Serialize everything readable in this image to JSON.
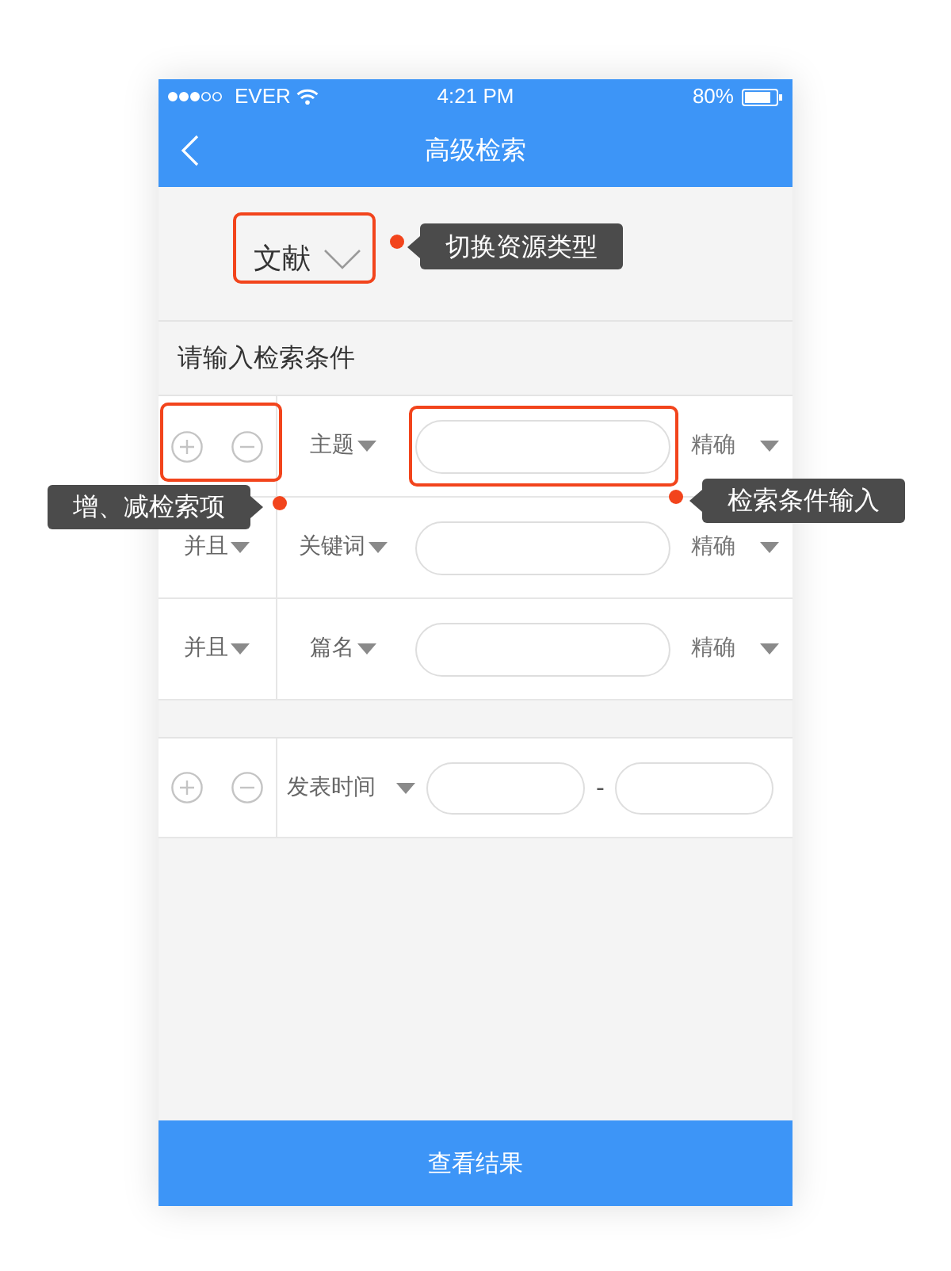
{
  "status_bar": {
    "carrier": "EVER",
    "time": "4:21 PM",
    "battery": "80%"
  },
  "nav_bar": {
    "title": "高级检索"
  },
  "resource_type": {
    "value": "文献"
  },
  "section_label": "请输入检索条件",
  "conditions": [
    {
      "kind": "add-remove",
      "field": "主题",
      "match": "精确"
    },
    {
      "kind": "logic",
      "logic": "并且",
      "field": "关键词",
      "match": "精确"
    },
    {
      "kind": "logic",
      "logic": "并且",
      "field": "篇名",
      "match": "精确"
    }
  ],
  "date_filter": {
    "field": "发表时间",
    "separator": "-"
  },
  "submit_button": "查看结果",
  "annotations": [
    {
      "kind": "resource-type",
      "text": "切换资源类型"
    },
    {
      "kind": "add-remove",
      "text": "增、减检索项"
    },
    {
      "kind": "condition-input",
      "text": "检索条件输入"
    }
  ]
}
